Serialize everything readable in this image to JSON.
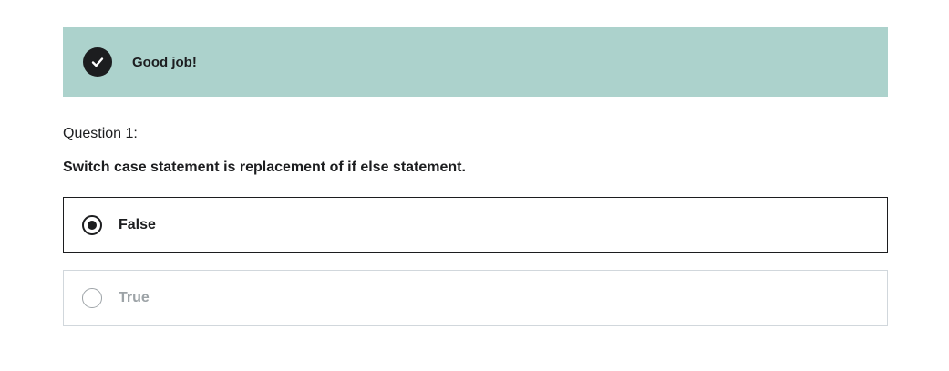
{
  "feedback": {
    "message": "Good job!",
    "icon": "check-circle-icon",
    "background_color": "#acd2cc"
  },
  "question": {
    "number_label": "Question 1:",
    "prompt": "Switch case statement is replacement of if else statement."
  },
  "options": [
    {
      "label": "False",
      "selected": true
    },
    {
      "label": "True",
      "selected": false
    }
  ]
}
